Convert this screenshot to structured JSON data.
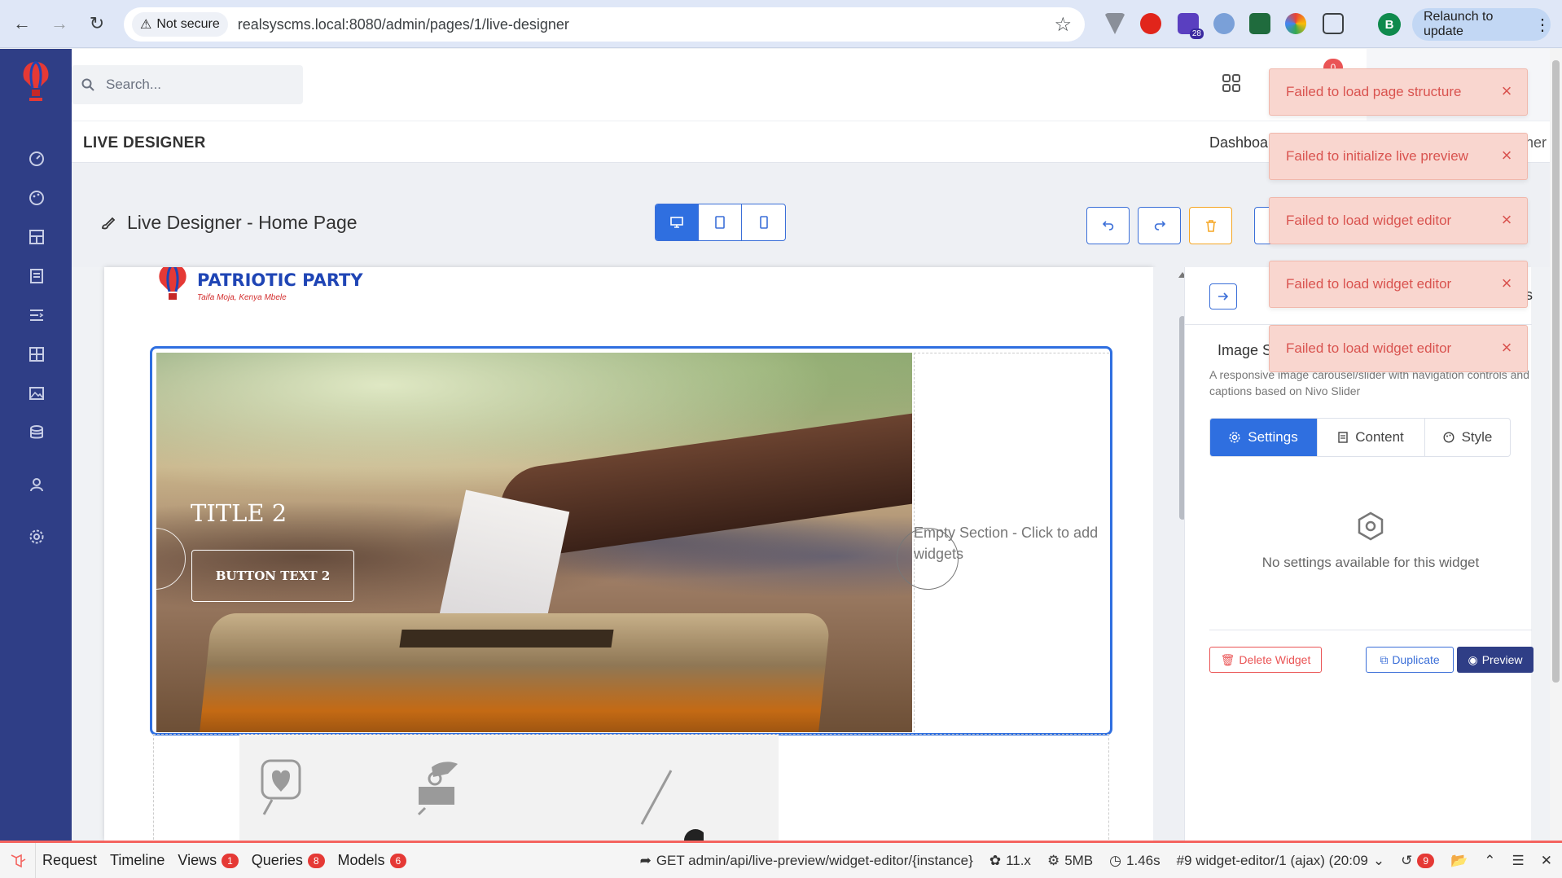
{
  "browser": {
    "security_label": "Not secure",
    "url": "realsyscms.local:8080/admin/pages/1/live-designer",
    "relaunch_label": "Relaunch to update",
    "profile_initial": "B",
    "extension_badge": "28"
  },
  "appbar": {
    "search_placeholder": "Search...",
    "notification_count": "0"
  },
  "subheader": {
    "title": "LIVE DESIGNER",
    "breadcrumb_home": "Dashboa",
    "breadcrumb_current": "ner"
  },
  "designer": {
    "title": "Live Designer - Home Page",
    "active_device": "desktop"
  },
  "canvas": {
    "party_name": "PATRIOTIC PARTY",
    "party_tagline": "Taifa Moja, Kenya Mbele",
    "slide_title": "TITLE 2",
    "slide_button": "BUTTON TEXT 2",
    "empty_section_text": "Empty Section - Click to add widgets"
  },
  "panel": {
    "widget_name": "Image S",
    "panel_heading_tail": "s",
    "widget_description": "A responsive image carousel/slider with navigation controls and captions based on Nivo Slider",
    "tabs": [
      {
        "label": "Settings",
        "icon": "gear-icon",
        "active": true
      },
      {
        "label": "Content",
        "icon": "document-icon",
        "active": false
      },
      {
        "label": "Style",
        "icon": "palette-icon",
        "active": false
      }
    ],
    "no_settings_text": "No settings available for this widget",
    "delete_label": "Delete Widget",
    "duplicate_label": "Duplicate",
    "preview_label": "Preview"
  },
  "toasts": [
    "Failed to load page structure",
    "Failed to initialize live preview",
    "Failed to load widget editor",
    "Failed to load widget editor",
    "Failed to load widget editor"
  ],
  "debugbar": {
    "request_label": "Request",
    "timeline_label": "Timeline",
    "views_label": "Views",
    "views_count": "1",
    "queries_label": "Queries",
    "queries_count": "8",
    "models_label": "Models",
    "models_count": "6",
    "route": "GET admin/api/live-preview/widget-editor/{instance}",
    "version": "11.x",
    "memory": "5MB",
    "duration": "1.46s",
    "request_select": "#9 widget-editor/1 (ajax) (20:09",
    "history_count": "9"
  },
  "colors": {
    "sidebar": "#2f3e86",
    "primary": "#2f6fe0",
    "danger": "#ea5455",
    "toast_bg": "#f9d6cf"
  }
}
